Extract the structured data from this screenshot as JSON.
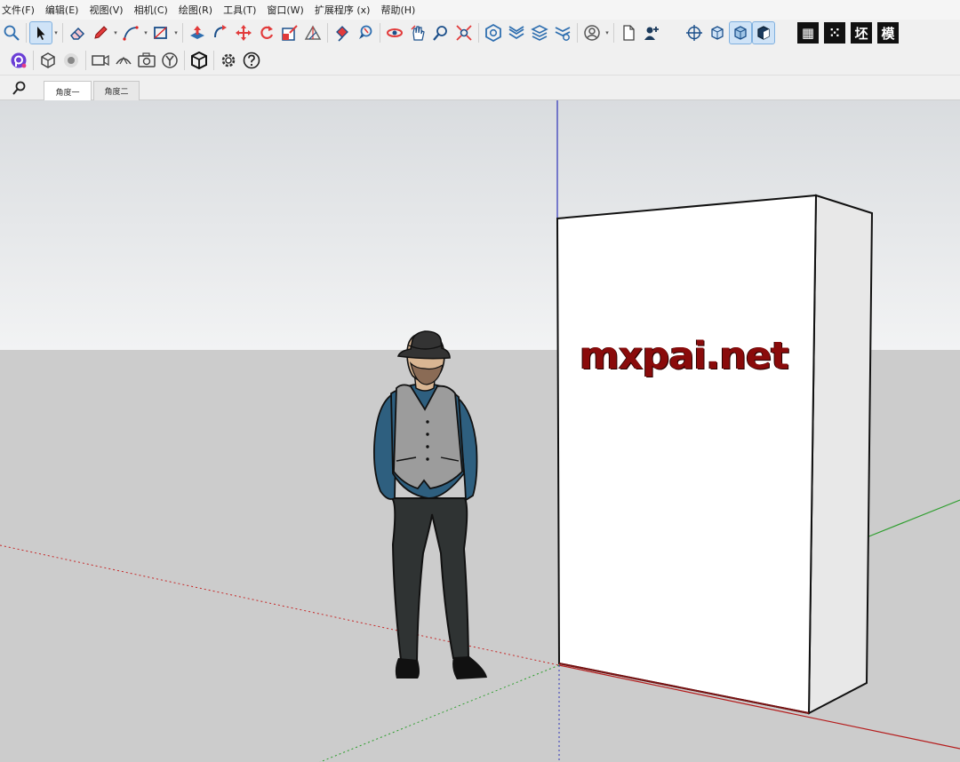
{
  "menu": [
    "文件(F)",
    "编辑(E)",
    "视图(V)",
    "相机(C)",
    "绘图(R)",
    "工具(T)",
    "窗口(W)",
    "扩展程序 (x)",
    "帮助(H)"
  ],
  "toolbar1": {
    "tools": [
      {
        "name": "zoom-icon"
      },
      {
        "name": "select-icon"
      },
      {
        "name": "eraser-icon"
      },
      {
        "name": "pencil-icon"
      },
      {
        "name": "arc-icon"
      },
      {
        "name": "rectangle-icon"
      },
      {
        "name": "push-pull-icon"
      },
      {
        "name": "follow-me-icon"
      },
      {
        "name": "move-icon"
      },
      {
        "name": "rotate-icon"
      },
      {
        "name": "scale-icon"
      },
      {
        "name": "protractor-icon"
      },
      {
        "name": "paint-bucket-icon"
      },
      {
        "name": "tape-measure-icon"
      },
      {
        "name": "orbit-icon"
      },
      {
        "name": "pan-icon"
      },
      {
        "name": "zoom-window-icon"
      },
      {
        "name": "zoom-extents-icon"
      },
      {
        "name": "warehouse-icon"
      },
      {
        "name": "sandbox-icon"
      },
      {
        "name": "layers-icon"
      },
      {
        "name": "extensions-icon"
      },
      {
        "name": "account-icon"
      },
      {
        "name": "new-file-icon"
      },
      {
        "name": "add-user-icon"
      },
      {
        "name": "section-plane-icon"
      },
      {
        "name": "xray-icon"
      },
      {
        "name": "shaded-icon"
      },
      {
        "name": "textured-icon"
      }
    ],
    "extension_labels": [
      "目",
      "☷",
      "坯",
      "模"
    ]
  },
  "toolbar2": {
    "tools": [
      {
        "name": "plugin-logo-icon"
      },
      {
        "name": "iso-view-icon"
      },
      {
        "name": "target-icon"
      },
      {
        "name": "camera-video-icon"
      },
      {
        "name": "walk-icon"
      },
      {
        "name": "photo-camera-icon"
      },
      {
        "name": "y-axis-icon"
      },
      {
        "name": "component-box-icon"
      },
      {
        "name": "settings-gear-icon"
      },
      {
        "name": "help-icon"
      }
    ]
  },
  "tabs": [
    {
      "label": "角度一",
      "active": true
    },
    {
      "label": "角度二",
      "active": false
    }
  ],
  "scene": {
    "brand_text": "mxpai.net",
    "colors": {
      "sky_top": "#d9dcdf",
      "sky_bottom": "#f2f3f4",
      "ground": "#cccccc",
      "block_front": "#ffffff",
      "block_side": "#e6e6e6",
      "axis_red": "#c62828",
      "axis_green": "#2e9e2e",
      "axis_blue": "#2e33b8",
      "brand_color": "#8a0b0b"
    }
  }
}
